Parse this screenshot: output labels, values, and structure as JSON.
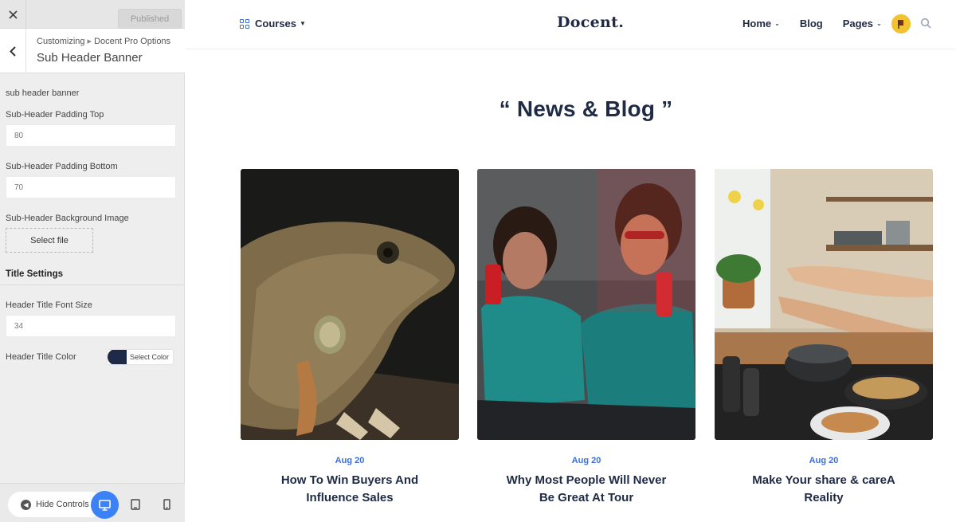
{
  "customizer": {
    "publish_label": "Published",
    "breadcrumb_root": "Customizing",
    "breadcrumb_separator": "▸",
    "breadcrumb_parent": "Docent Pro Options",
    "section_title": "Sub Header Banner",
    "section_label": "sub header banner",
    "padding_top_label": "Sub-Header Padding Top",
    "padding_top_value": "80",
    "padding_bottom_label": "Sub-Header Padding Bottom",
    "padding_bottom_value": "70",
    "bg_image_label": "Sub-Header Background Image",
    "select_file_label": "Select file",
    "title_settings_heading": "Title Settings",
    "font_size_label": "Header Title Font Size",
    "font_size_value": "34",
    "title_color_label": "Header Title Color",
    "select_color_label": "Select Color",
    "title_color_value": "#1e2a47",
    "hide_controls_label": "Hide Controls",
    "active_device": "desktop"
  },
  "site": {
    "nav_courses": "Courses",
    "logo": "Docent.",
    "nav_home": "Home",
    "nav_blog": "Blog",
    "nav_pages": "Pages",
    "heading": "“ News & Blog ”",
    "accent_color": "#3b6fd6",
    "posts": [
      {
        "date": "Aug 20",
        "title": "How To Win Buyers And Influence Sales",
        "image": "iguana-photo"
      },
      {
        "date": "Aug 20",
        "title": "Why Most People Will Never Be Great At Tour",
        "image": "women-drinking-soda-photo"
      },
      {
        "date": "Aug 20",
        "title": "Make Your share & careA Reality",
        "image": "kitchen-cooking-photo"
      }
    ]
  }
}
